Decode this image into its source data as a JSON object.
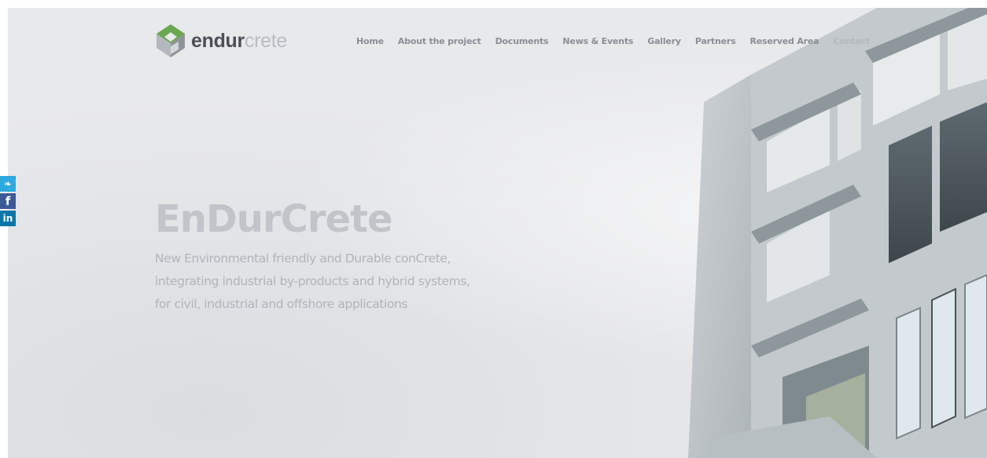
{
  "brand": {
    "name_part1": "endur",
    "name_part2": "crete",
    "logo_icon": "concrete-cube-logo",
    "colors": {
      "green": "#5a9a3a",
      "dark": "#4a4f58",
      "light": "#b9bcc2"
    }
  },
  "nav": {
    "items": [
      {
        "label": "Home"
      },
      {
        "label": "About the project"
      },
      {
        "label": "Documents"
      },
      {
        "label": "News & Events"
      },
      {
        "label": "Gallery"
      },
      {
        "label": "Partners"
      },
      {
        "label": "Reserved Area"
      },
      {
        "label": "Contact"
      }
    ]
  },
  "social": {
    "twitter_icon": "twitter-icon",
    "twitter_glyph": "❧",
    "facebook_icon": "facebook-icon",
    "facebook_glyph": "f",
    "linkedin_icon": "linkedin-icon",
    "linkedin_glyph": "in"
  },
  "hero": {
    "title": "EnDurCrete",
    "lines": [
      "New Environmental friendly and Durable conCrete,",
      "integrating industrial by-products and hybrid systems,",
      "for civil, industrial and offshore applications"
    ]
  }
}
